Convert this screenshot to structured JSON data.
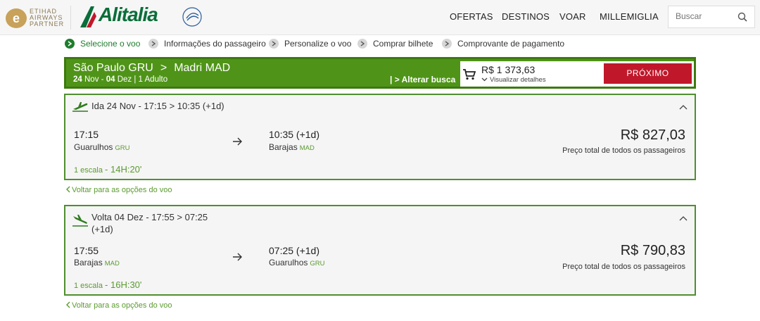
{
  "header": {
    "partner_line1": "ETIHAD",
    "partner_line2": "AIRWAYS",
    "partner_line3": "PARTNER",
    "brand": "Alitalia",
    "nav": [
      "OFERTAS",
      "DESTINOS",
      "VOAR",
      "MILLEMIGLIA"
    ],
    "search_placeholder": "Buscar"
  },
  "steps": [
    {
      "label": "Selecione o voo",
      "active": true
    },
    {
      "label": "Informações do passageiro",
      "active": false
    },
    {
      "label": "Personalize o voo",
      "active": false
    },
    {
      "label": "Comprar bilhete",
      "active": false
    },
    {
      "label": "Comprovante de pagamento",
      "active": false
    }
  ],
  "summary": {
    "origin": "São Paulo GRU",
    "arrow": ">",
    "destination": "Madri MAD",
    "date_from": "24",
    "month_from": "Nov",
    "date_sep": "-",
    "date_to": "04",
    "month_to": "Dez",
    "passengers": "| 1 Adulto",
    "change_search": "| > Alterar busca",
    "total": "R$ 1 373,63",
    "details": "Visualizar detalhes",
    "next": "PRÓXIMO"
  },
  "flights": [
    {
      "title": "Ida 24 Nov - 17:15 > 10:35 (+1d)",
      "title_line2": "",
      "dep_time": "17:15",
      "dep_airport": "Guarulhos",
      "dep_code": "GRU",
      "arr_time": "10:35 (+1d)",
      "arr_airport": "Barajas",
      "arr_code": "MAD",
      "price": "R$ 827,03",
      "price_note": "Preço total de todos os passageiros",
      "stops": "1 escala",
      "duration": "- 14H:20'"
    },
    {
      "title": "Volta 04 Dez - 17:55 > 07:25",
      "title_line2": "(+1d)",
      "dep_time": "17:55",
      "dep_airport": "Barajas",
      "dep_code": "MAD",
      "arr_time": "07:25 (+1d)",
      "arr_airport": "Guarulhos",
      "arr_code": "GRU",
      "price": "R$ 790,83",
      "price_note": "Preço total de todos os passageiros",
      "stops": "1 escala",
      "duration": "- 16H:30'"
    }
  ],
  "back_link": "Voltar para as opções do voo",
  "colors": {
    "green": "#4f9418",
    "red": "#c0182a",
    "brand": "#0a6e3a"
  }
}
